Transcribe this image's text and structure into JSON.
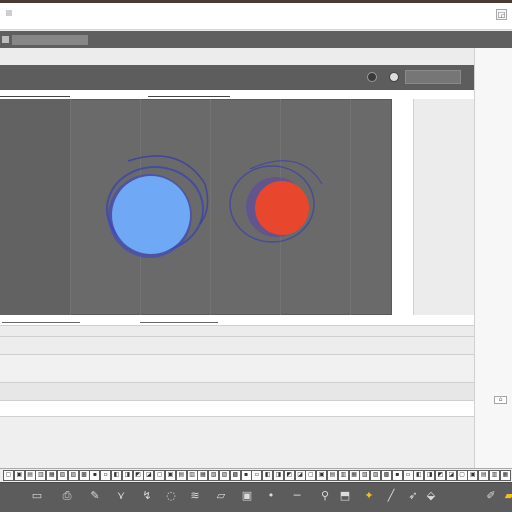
{
  "titlebar": {
    "title": "",
    "window_button_glyph": "◲"
  },
  "toolbar": {
    "field_value": ""
  },
  "panel": {
    "title": "",
    "search_value": ""
  },
  "viewport": {
    "tab_left_label": "",
    "tab_right_label": "",
    "footer_left_label": "",
    "footer_right_label": "",
    "objects": [
      {
        "name": "blue-sphere",
        "color": "#6fa8f5",
        "rim_color": "#3340b8"
      },
      {
        "name": "red-sphere",
        "color": "#e8472e",
        "rim_color": "#3b3fa8"
      }
    ]
  },
  "colors": {
    "viewport_bg": "#6a6a6a",
    "toolbar_bg": "#5c5c5c",
    "accent_yellow": "#f0c020"
  },
  "mini_toolbar": {
    "buttons": [
      "▢",
      "▣",
      "▤",
      "▥",
      "▦",
      "▧",
      "▨",
      "▩",
      "▪",
      "▫",
      "◧",
      "◨",
      "◩",
      "◪",
      "▢",
      "▣",
      "▤",
      "▥",
      "▦",
      "▧",
      "▨",
      "▩",
      "▪",
      "▫",
      "◧",
      "◨",
      "◩",
      "◪",
      "▢",
      "▣",
      "▤",
      "▥",
      "▦",
      "▧",
      "▨",
      "▩",
      "▪",
      "▫",
      "◧",
      "◨",
      "◩",
      "◪",
      "▢",
      "▣",
      "▤",
      "▥",
      "▦"
    ]
  },
  "icon_toolbar": {
    "icons": [
      {
        "name": "frame-icon",
        "glyph": "▭"
      },
      {
        "name": "file-icon",
        "glyph": "⎙"
      },
      {
        "name": "pen-icon",
        "glyph": "✎"
      },
      {
        "name": "vector-icon",
        "glyph": "⋎"
      },
      {
        "name": "curve-icon",
        "glyph": "↯"
      },
      {
        "name": "ellipse-icon",
        "glyph": "◌"
      },
      {
        "name": "layers-icon",
        "glyph": "≋"
      },
      {
        "name": "rect-icon",
        "glyph": "▱"
      },
      {
        "name": "image-icon",
        "glyph": "▣"
      },
      {
        "name": "point-icon",
        "glyph": "•"
      },
      {
        "name": "line-icon",
        "glyph": "─"
      },
      {
        "name": "pin-icon",
        "glyph": "⚲"
      },
      {
        "name": "tag-icon",
        "glyph": "⬒"
      },
      {
        "name": "star-icon",
        "glyph": "✦"
      },
      {
        "name": "brush-icon",
        "glyph": "╱"
      },
      {
        "name": "pointer-icon",
        "glyph": "➶"
      },
      {
        "name": "highlight-icon",
        "glyph": "⬙"
      },
      {
        "name": "edit-icon",
        "glyph": "✐"
      },
      {
        "name": "folder-icon",
        "glyph": "▰"
      }
    ]
  }
}
